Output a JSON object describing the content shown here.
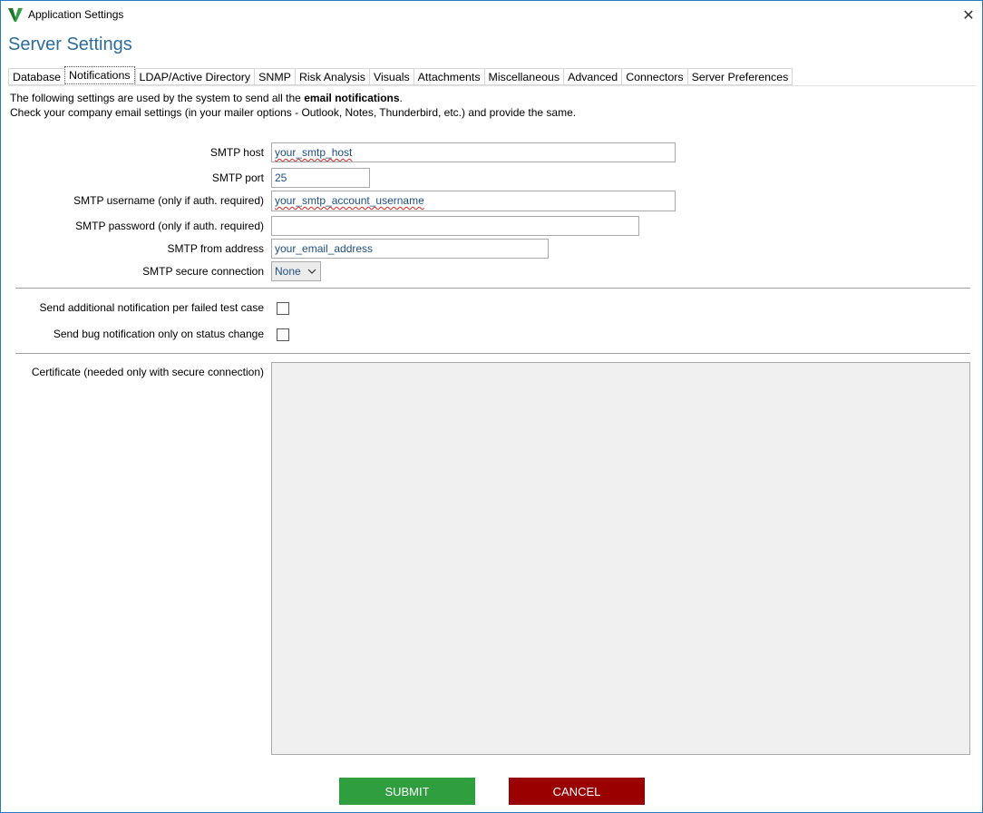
{
  "window": {
    "title": "Application Settings",
    "close_symbol": "✕"
  },
  "page_title": "Server Settings",
  "tabs": [
    {
      "label": "Database",
      "active": false
    },
    {
      "label": "Notifications",
      "active": true
    },
    {
      "label": "LDAP/Active Directory",
      "active": false
    },
    {
      "label": "SNMP",
      "active": false
    },
    {
      "label": "Risk Analysis",
      "active": false
    },
    {
      "label": "Visuals",
      "active": false
    },
    {
      "label": "Attachments",
      "active": false
    },
    {
      "label": "Miscellaneous",
      "active": false
    },
    {
      "label": "Advanced",
      "active": false
    },
    {
      "label": "Connectors",
      "active": false
    },
    {
      "label": "Server Preferences",
      "active": false
    }
  ],
  "intro": {
    "line1_prefix": "The following settings are used by the system to send all the ",
    "line1_bold": "email notifications",
    "line1_suffix": ".",
    "line2": "Check your company email settings (in your mailer options - Outlook, Notes, Thunderbird, etc.) and provide the same."
  },
  "form": {
    "smtp_host": {
      "label": "SMTP host",
      "value": "your_smtp_host"
    },
    "smtp_port": {
      "label": "SMTP port",
      "value": "25"
    },
    "smtp_username": {
      "label": "SMTP username (only if auth. required)",
      "value": "your_smtp_account_username"
    },
    "smtp_password": {
      "label": "SMTP password (only if auth. required)",
      "value": ""
    },
    "smtp_from": {
      "label": "SMTP from address",
      "value": "your_email_address"
    },
    "smtp_secure": {
      "label": "SMTP secure connection",
      "value": "None"
    },
    "notify_failed_test": {
      "label": "Send additional notification per failed test case",
      "checked": false
    },
    "bug_status_only": {
      "label": "Send bug notification only on status change",
      "checked": false
    },
    "certificate": {
      "label": "Certificate (needed only with secure connection)",
      "value": ""
    }
  },
  "buttons": {
    "submit": "SUBMIT",
    "cancel": "CANCEL"
  },
  "colors": {
    "submit": "#2e9e3e",
    "cancel": "#9b0000",
    "title": "#2e6c9a",
    "field_text": "#1e4f82"
  },
  "icons": {
    "app": "app-logo-icon",
    "close": "close-icon",
    "dropdown": "chevron-down-icon"
  }
}
